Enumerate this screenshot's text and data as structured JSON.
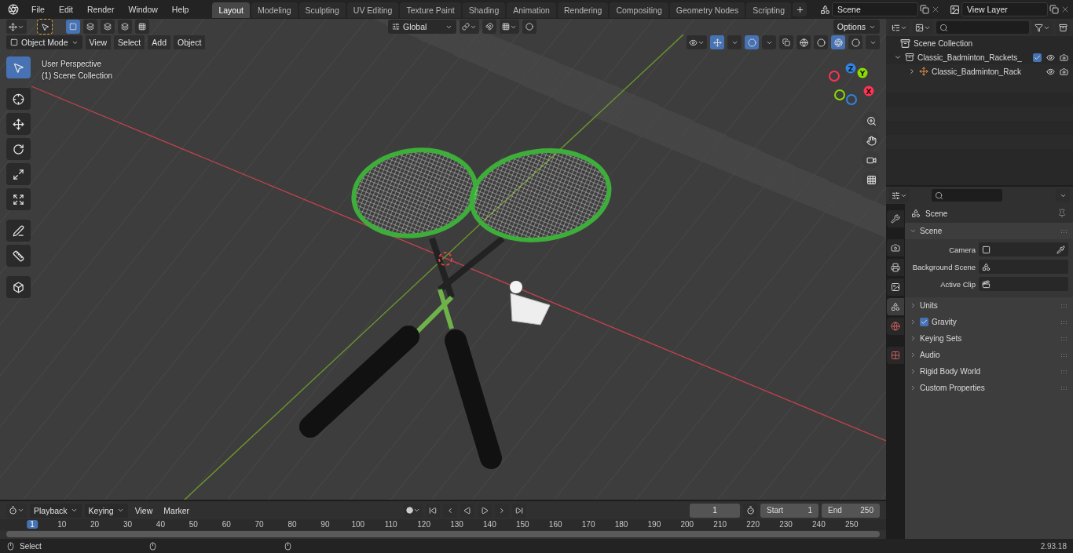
{
  "top_menu": [
    "File",
    "Edit",
    "Render",
    "Window",
    "Help"
  ],
  "workspaces": [
    {
      "label": "Layout",
      "selected": true
    },
    {
      "label": "Modeling",
      "selected": false
    },
    {
      "label": "Sculpting",
      "selected": false
    },
    {
      "label": "UV Editing",
      "selected": false
    },
    {
      "label": "Texture Paint",
      "selected": false
    },
    {
      "label": "Shading",
      "selected": false
    },
    {
      "label": "Animation",
      "selected": false
    },
    {
      "label": "Rendering",
      "selected": false
    },
    {
      "label": "Compositing",
      "selected": false
    },
    {
      "label": "Geometry Nodes",
      "selected": false
    },
    {
      "label": "Scripting",
      "selected": false
    }
  ],
  "scene_selector": "Scene",
  "view_layer_selector": "View Layer",
  "viewport": {
    "orientation": "Global",
    "options": "Options",
    "mode": "Object Mode",
    "menus": [
      "View",
      "Select",
      "Add",
      "Object"
    ],
    "tools": [
      {
        "kind": "select",
        "selected": true
      },
      {
        "kind": "cursor",
        "selected": false
      },
      {
        "kind": "move",
        "selected": false
      },
      {
        "kind": "rotate",
        "selected": false
      },
      {
        "kind": "scale",
        "selected": false
      },
      {
        "kind": "transform",
        "selected": false
      },
      {
        "kind": "annotate",
        "selected": false
      },
      {
        "kind": "measure",
        "selected": false
      },
      {
        "kind": "add_cube",
        "selected": false
      }
    ],
    "info": [
      "User Perspective",
      "(1) Scene Collection"
    ],
    "gizmo": [
      {
        "label": "Z",
        "color": "#2f83e3"
      },
      {
        "label": "Y",
        "color": "#8bdc00"
      },
      {
        "label": "X",
        "color": "#ff3352"
      }
    ],
    "shading": [
      {
        "kind": "wireframe",
        "selected": false
      },
      {
        "kind": "solid",
        "selected": false
      },
      {
        "kind": "material",
        "selected": true
      },
      {
        "kind": "rendered",
        "selected": false
      }
    ]
  },
  "outliner": {
    "root": "Scene Collection",
    "items": [
      {
        "label": "Classic_Badminton_Rackets_",
        "kind": "collection",
        "expanded": true,
        "checked": true,
        "children": [
          {
            "label": "Classic_Badminton_Rack",
            "kind": "empty",
            "expanded": false
          }
        ]
      }
    ]
  },
  "properties": {
    "tabs": [
      {
        "kind": "tool",
        "selected": false
      },
      {
        "kind": "render",
        "selected": false
      },
      {
        "kind": "output",
        "selected": false
      },
      {
        "kind": "view_layer",
        "selected": false
      },
      {
        "kind": "scene",
        "selected": true
      },
      {
        "kind": "world",
        "selected": false
      },
      {
        "kind": "texture",
        "selected": false
      }
    ],
    "context": "Scene",
    "panels": [
      {
        "title": "Scene",
        "expanded": true,
        "fields": [
          {
            "label": "Camera",
            "kind": "camera"
          },
          {
            "label": "Background Scene",
            "kind": "scene"
          },
          {
            "label": "Active Clip",
            "kind": "clip"
          }
        ]
      },
      {
        "title": "Units",
        "expanded": false
      },
      {
        "title": "Gravity",
        "expanded": false,
        "checked": true
      },
      {
        "title": "Keying Sets",
        "expanded": false
      },
      {
        "title": "Audio",
        "expanded": false
      },
      {
        "title": "Rigid Body World",
        "expanded": false
      },
      {
        "title": "Custom Properties",
        "expanded": false
      }
    ]
  },
  "timeline": {
    "menus": [
      "Playback",
      "Keying",
      "View",
      "Marker"
    ],
    "current_frame": "1",
    "start_label": "Start",
    "start": "1",
    "end_label": "End",
    "end": "250",
    "ruler": [
      {
        "label": "1",
        "selected": true
      },
      {
        "label": "10",
        "selected": false
      },
      {
        "label": "20",
        "selected": false
      },
      {
        "label": "30",
        "selected": false
      },
      {
        "label": "40",
        "selected": false
      },
      {
        "label": "50",
        "selected": false
      },
      {
        "label": "60",
        "selected": false
      },
      {
        "label": "70",
        "selected": false
      },
      {
        "label": "80",
        "selected": false
      },
      {
        "label": "90",
        "selected": false
      },
      {
        "label": "100",
        "selected": false
      },
      {
        "label": "110",
        "selected": false
      },
      {
        "label": "120",
        "selected": false
      },
      {
        "label": "130",
        "selected": false
      },
      {
        "label": "140",
        "selected": false
      },
      {
        "label": "150",
        "selected": false
      },
      {
        "label": "160",
        "selected": false
      },
      {
        "label": "170",
        "selected": false
      },
      {
        "label": "180",
        "selected": false
      },
      {
        "label": "190",
        "selected": false
      },
      {
        "label": "200",
        "selected": false
      },
      {
        "label": "210",
        "selected": false
      },
      {
        "label": "220",
        "selected": false
      },
      {
        "label": "230",
        "selected": false
      },
      {
        "label": "240",
        "selected": false
      },
      {
        "label": "250",
        "selected": false
      }
    ]
  },
  "status_bar": {
    "action": "Select",
    "version": "2.93.18"
  }
}
